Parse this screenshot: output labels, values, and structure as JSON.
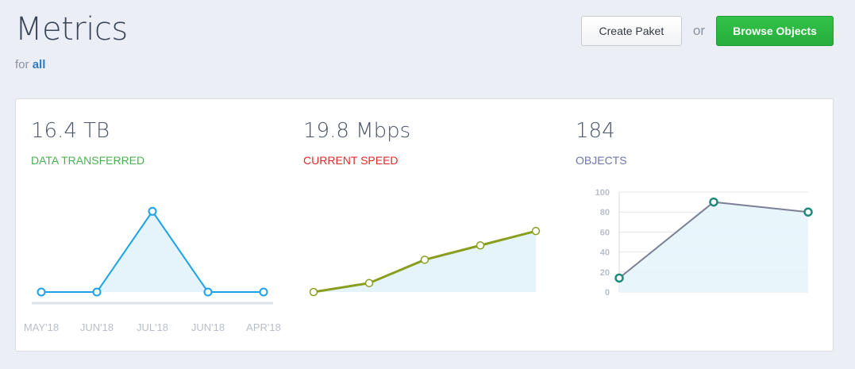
{
  "header": {
    "title": "Metrics",
    "subtitle_prefix": "for",
    "subtitle_scope": "all",
    "create_label": "Create Paket",
    "or_label": "or",
    "browse_label": "Browse Objects"
  },
  "metrics": [
    {
      "value": "16.4 TB",
      "label": "DATA TRANSFERRED",
      "color": "#4cb050"
    },
    {
      "value": "19.8 Mbps",
      "label": "CURRENT SPEED",
      "color": "#e02b2b"
    },
    {
      "value": "184",
      "label": "OBJECTS",
      "color": "#6b76b4"
    }
  ],
  "chart_data": [
    {
      "type": "line",
      "categories": [
        "MAY'18",
        "JUN'18",
        "JUL'18",
        "JUN'18",
        "APR'18"
      ],
      "values": [
        0,
        0,
        90,
        0,
        0
      ],
      "color": "#1aa3e8",
      "grid": false
    },
    {
      "type": "area",
      "values": [
        0,
        10,
        36,
        52,
        68
      ],
      "color": "#8a9e1e",
      "grid": false
    },
    {
      "type": "line",
      "values": [
        14,
        90,
        80
      ],
      "ylim": [
        0,
        100
      ],
      "yticks": [
        "100",
        "80",
        "60",
        "40",
        "20",
        "0"
      ],
      "color": "#7b8096",
      "point_color": "#1f8a7a",
      "grid": true
    }
  ]
}
